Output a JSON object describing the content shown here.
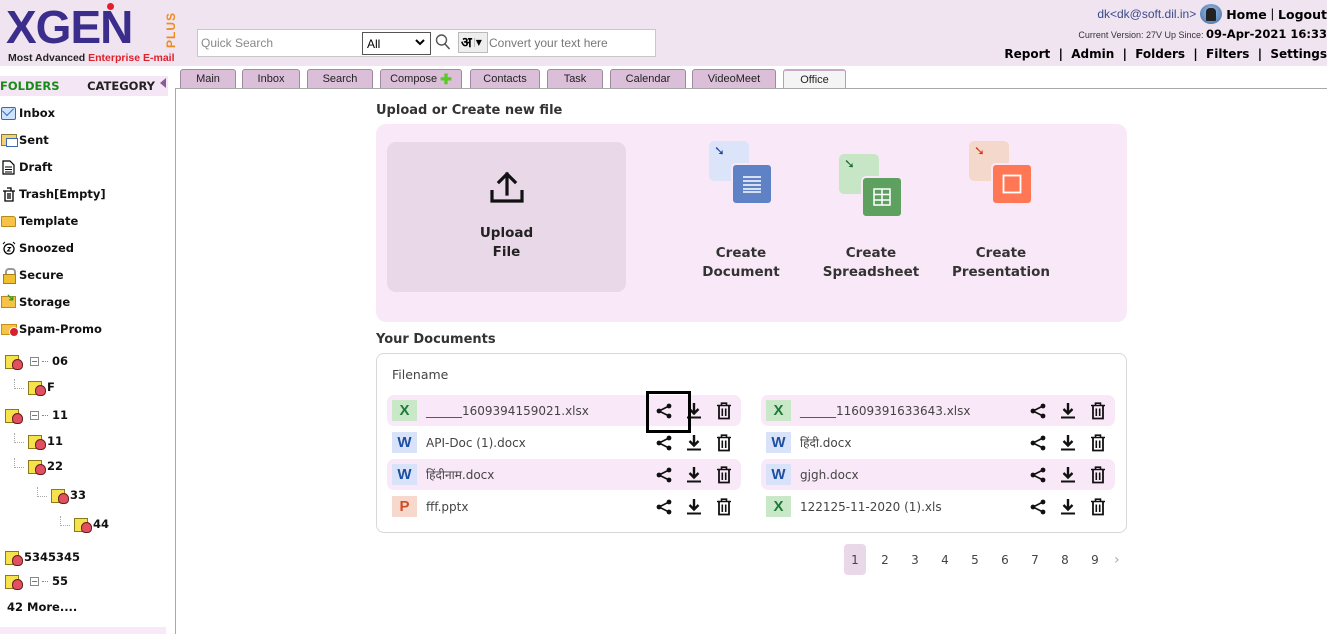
{
  "header": {
    "logo": {
      "brand": "XGEN",
      "plus": "PLUS",
      "tagline_prefix": "Most Advanced ",
      "tagline_highlight": "Enterprise E-mail"
    },
    "search": {
      "placeholder": "Quick Search",
      "value": "",
      "scope_selected": "All",
      "convert_lang_glyph": "अ",
      "convert_placeholder": "Convert your text here"
    },
    "user": {
      "email": "dk<dk@soft.dil.in>",
      "home_label": "Home",
      "logout_label": "Logout"
    },
    "version": {
      "label": "Current Version: 27V Up Since:",
      "date": "09-Apr-2021 16:33"
    },
    "nav_links": [
      "Report",
      "Admin",
      "Folders",
      "Filters",
      "Settings"
    ]
  },
  "sidebar": {
    "folders_label": "FOLDERS",
    "category_label": "CATEGORY",
    "system_folders": [
      {
        "label": "Inbox",
        "icon": "inbox-icon"
      },
      {
        "label": "Sent",
        "icon": "sent-icon"
      },
      {
        "label": "Draft",
        "icon": "draft-icon"
      },
      {
        "label": "Trash[Empty]",
        "icon": "trash-icon"
      },
      {
        "label": "Template",
        "icon": "template-folder-icon"
      },
      {
        "label": "Snoozed",
        "icon": "alarm-clock-icon"
      },
      {
        "label": "Secure",
        "icon": "lock-icon"
      },
      {
        "label": "Storage",
        "icon": "storage-folder-icon"
      },
      {
        "label": "Spam-Promo",
        "icon": "spam-icon"
      }
    ],
    "user_folders": [
      {
        "label": "06",
        "level": 0,
        "expanded": true
      },
      {
        "label": "F",
        "level": 1
      },
      {
        "label": "11",
        "level": 0,
        "expanded": true
      },
      {
        "label": "11",
        "level": 1
      },
      {
        "label": "22",
        "level": 1
      },
      {
        "label": "33",
        "level": 2
      },
      {
        "label": "44",
        "level": 3
      },
      {
        "label": "5345345",
        "level": 0
      },
      {
        "label": "55",
        "level": 0,
        "expanded": true
      }
    ],
    "more_label": "42 More...."
  },
  "tabs": [
    {
      "label": "Main",
      "active": false
    },
    {
      "label": "Inbox",
      "active": false
    },
    {
      "label": "Search",
      "active": false
    },
    {
      "label": "Compose",
      "active": false,
      "has_plus": true
    },
    {
      "label": "Contacts",
      "active": false
    },
    {
      "label": "Task",
      "active": false
    },
    {
      "label": "Calendar",
      "active": false
    },
    {
      "label": "VideoMeet",
      "active": false
    },
    {
      "label": "Office",
      "active": true
    }
  ],
  "office": {
    "create_section_title": "Upload or Create new file",
    "upload": {
      "line1": "Upload",
      "line2": "File"
    },
    "create_items": [
      {
        "line1": "Create",
        "line2": "Document",
        "kind": "document",
        "colors": {
          "back": "#dbe4f8",
          "front": "#5f82c6",
          "arrow": "#1e4a9a"
        }
      },
      {
        "line1": "Create",
        "line2": "Spreadsheet",
        "kind": "spreadsheet",
        "colors": {
          "back": "#c6e6c6",
          "front": "#5ea060",
          "arrow": "#1f6a2a"
        }
      },
      {
        "line1": "Create",
        "line2": "Presentation",
        "kind": "presentation",
        "colors": {
          "back": "#f4d8cc",
          "front": "#ff7755",
          "arrow": "#d43a1a"
        }
      }
    ],
    "documents_title": "Your Documents",
    "filename_header": "Filename",
    "documents": [
      {
        "name": "______1609394159021.xlsx",
        "type": "X"
      },
      {
        "name": "______11609391633643.xlsx",
        "type": "X"
      },
      {
        "name": "API-Doc (1).docx",
        "type": "W"
      },
      {
        "name": "हिंदी.docx",
        "type": "W"
      },
      {
        "name": "हिंदीनाम.docx",
        "type": "W"
      },
      {
        "name": "gjgh.docx",
        "type": "W"
      },
      {
        "name": "fff.pptx",
        "type": "P"
      },
      {
        "name": "122125-11-2020 (1).xls",
        "type": "X"
      }
    ],
    "pagination": {
      "pages": [
        "1",
        "2",
        "3",
        "4",
        "5",
        "6",
        "7",
        "8",
        "9"
      ],
      "current": "1",
      "next_label": "›"
    }
  }
}
